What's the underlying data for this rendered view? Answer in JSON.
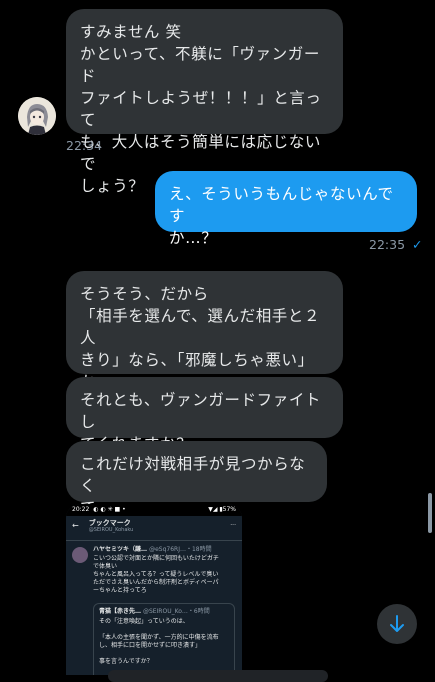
{
  "messages": [
    {
      "text": "すみません 笑\nかといって、不躾に「ヴァンガード\nファイトしようぜ！！！」と言って\nも、大人はそう簡単には応じないで\nしょう？"
    },
    {
      "text": "え、そういうもんじゃないんです\nか…？"
    },
    {
      "text": "そうそう、だから\n「相手を選んで、選んだ相手と２人\nきり」なら、「邪魔しちゃ悪い」か\nなと"
    },
    {
      "text": "それとも、ヴァンガードファイトし\nてくれますか？"
    },
    {
      "text": "これだけ対戦相手が見つからなく\nて、"
    }
  ],
  "timestamps": {
    "received": "22:34",
    "sent": "22:35"
  },
  "read_receipt": "✓",
  "attachment": {
    "status_time": "20:22",
    "status_icons": "◐ ◐ ✳ ■ •",
    "status_right": "▼◢ ▮57%",
    "back": "←",
    "title": "ブックマーク",
    "subtitle": "@SEIROU_Kohaku",
    "more": "···",
    "tweet_name": "ハヤセミツキ（謙…",
    "tweet_handle": "@eSq76RJ…・18時間",
    "tweet_body": "こいつ公認で対面とか隣に何回もいたけどガチ\nで体臭い\nちゃんと風呂入ってる？って疑うレベルで臭い\nただでさえ臭いんだから制汗剤とボディペーパ\nーちゃんと持ってろ",
    "quote_name": "青猫【赤き先…",
    "quote_handle": "@SEIROU_Ko…・6時間",
    "quote_body": "その「注意喚起」っていうのは、\n\n「本人の主張を聞かず、一方的に中傷を流布\nし、相手に口を開かせずに叩き潰す」\n\n事を言うんですか？"
  },
  "icons": {
    "scroll_down": "arrow-down-icon"
  },
  "colors": {
    "background": "#000000",
    "bubble_in": "#2f3336",
    "bubble_out": "#1d9bf0",
    "accent": "#1d9bf0"
  }
}
